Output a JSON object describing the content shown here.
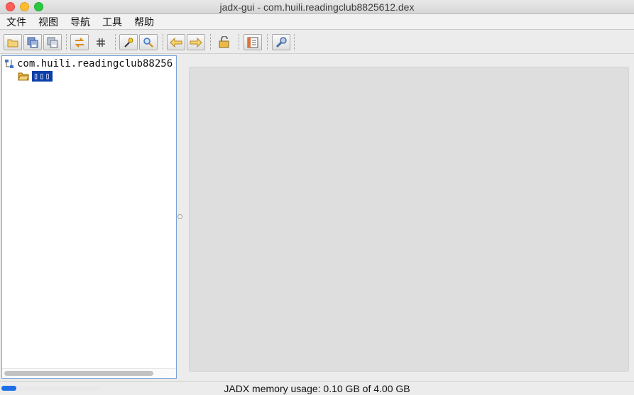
{
  "window": {
    "title": "jadx-gui - com.huili.readingclub8825612.dex"
  },
  "menu": {
    "items": [
      "文件",
      "视图",
      "导航",
      "工具",
      "帮助"
    ]
  },
  "toolbar": {
    "buttons": [
      {
        "icon": "open-folder-icon"
      },
      {
        "icon": "save-all-icon"
      },
      {
        "icon": "export-icon"
      },
      {
        "icon": "sync-icon"
      },
      {
        "icon": "flatten-packages-icon"
      },
      {
        "icon": "text-search-icon"
      },
      {
        "icon": "find-class-icon"
      },
      {
        "icon": "back-arrow-icon"
      },
      {
        "icon": "forward-arrow-icon"
      },
      {
        "icon": "deobfuscation-icon"
      },
      {
        "icon": "log-viewer-icon"
      },
      {
        "icon": "preferences-wrench-icon"
      }
    ]
  },
  "tree": {
    "root_label": "com.huili.readingclub88256",
    "child_label": "▯▯▯"
  },
  "status": {
    "memory_text": "JADX memory usage: 0.10 GB of 4.00 GB",
    "memory_fraction": 0.025
  },
  "colors": {
    "selection": "#0b3fa9",
    "memory_bar": "#1e6fe6",
    "folder": "#e7b33a"
  }
}
